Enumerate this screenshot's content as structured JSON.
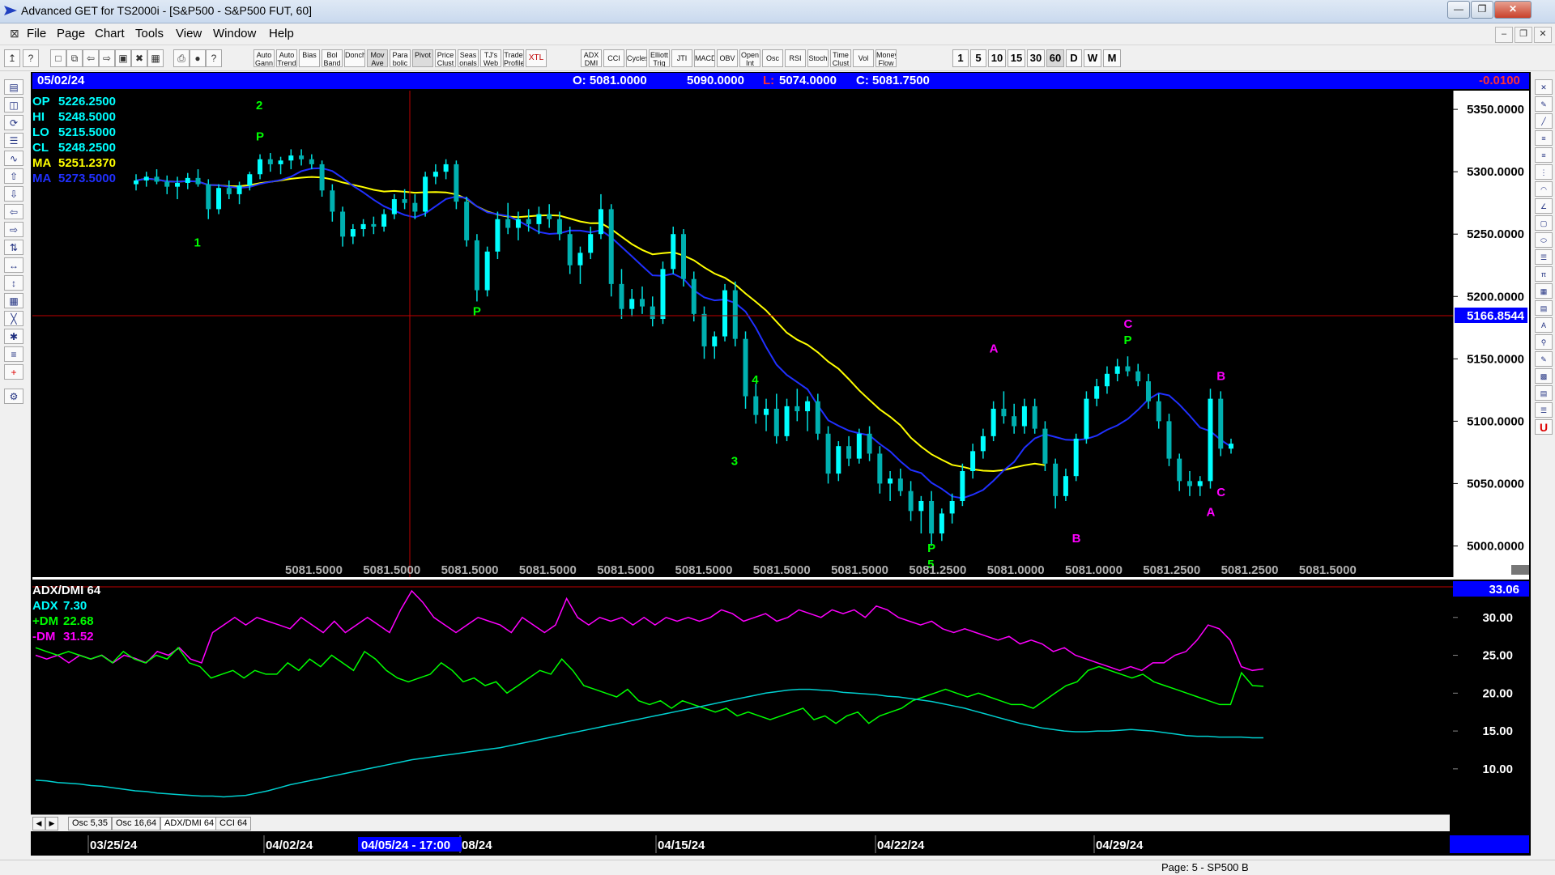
{
  "window": {
    "title": "Advanced GET for TS2000i - [S&P500 - S&P500 FUT, 60]"
  },
  "menu": [
    "File",
    "Page",
    "Chart",
    "Tools",
    "View",
    "Window",
    "Help"
  ],
  "toolbar": {
    "studies": [
      "Auto Gann",
      "Auto Trend",
      "Bias",
      "Bol Band",
      "Donch",
      "Mov Ave",
      "Para bolic",
      "Pivot",
      "Price Clust",
      "Seas onals",
      "TJ's Web",
      "Trade Profile",
      "XTL",
      "ADX DMI",
      "CCI",
      "Cycles",
      "Elliott Trig",
      "JTI",
      "MACD",
      "OBV",
      "Open Int",
      "Osc",
      "RSI",
      "Stoch",
      "Time Clust",
      "Vol",
      "Money Flow"
    ],
    "timeframes": [
      "1",
      "5",
      "10",
      "15",
      "30",
      "60",
      "D",
      "W",
      "M"
    ],
    "selected_timeframe": "60"
  },
  "infobar": {
    "date": "05/02/24",
    "open": "O: 5081.0000",
    "high": "5090.0000",
    "low_label": "L:",
    "low": "5074.0000",
    "close": "C: 5081.7500",
    "change": "-0.0100"
  },
  "price_panel": {
    "legend": [
      {
        "label": "OP",
        "value": "5226.2500",
        "color": "#00ffff"
      },
      {
        "label": "HI",
        "value": "5248.5000",
        "color": "#00ffff"
      },
      {
        "label": "LO",
        "value": "5215.5000",
        "color": "#00ffff"
      },
      {
        "label": "CL",
        "value": "5248.2500",
        "color": "#00ffff"
      },
      {
        "label": "MA",
        "value": "5251.2370",
        "color": "#ffff00"
      },
      {
        "label": "MA",
        "value": "5273.5000",
        "color": "#2030ff"
      }
    ],
    "axis_labels": [
      "5350.0000",
      "5300.0000",
      "5250.0000",
      "5200.0000",
      "5150.0000",
      "5100.0000",
      "5050.0000",
      "5000.0000"
    ],
    "crosshair_price": "5166.8544",
    "bottom_values": [
      "5081.5000",
      "5081.5000",
      "5081.5000",
      "5081.5000",
      "5081.5000",
      "5081.5000",
      "5081.5000",
      "5081.5000",
      "5081.2500",
      "5081.0000",
      "5081.0000",
      "5081.2500",
      "5081.2500",
      "5081.5000"
    ],
    "last_value": "5081.7500"
  },
  "indicator_panel": {
    "title": "ADX/DMI 64",
    "legend": [
      {
        "label": "ADX",
        "value": "7.30",
        "color": "#00ffff"
      },
      {
        "label": "+DM",
        "value": "22.68",
        "color": "#00ff00"
      },
      {
        "label": "-DM",
        "value": "31.52",
        "color": "#ff00ff"
      }
    ],
    "axis_labels": [
      "30.00",
      "25.00",
      "20.00",
      "15.00",
      "10.00"
    ],
    "crosshair_value": "33.06"
  },
  "tabs": [
    "Osc 5,35",
    "Osc 16,64",
    "ADX/DMI 64",
    "CCI 64"
  ],
  "active_tab": "ADX/DMI 64",
  "date_axis": {
    "labels": [
      "03/25/24",
      "04/02/24",
      "08/24",
      "04/15/24",
      "04/22/24",
      "04/29/24"
    ],
    "cursor_label": "04/05/24 - 17:00"
  },
  "status": "Page: 5 - SP500 B",
  "chart_data": {
    "type": "candlestick",
    "ylim": [
      4975,
      5365
    ],
    "labels": [
      {
        "text": "1",
        "color": "#00ff00",
        "price": 5240
      },
      {
        "text": "2",
        "color": "#00ff00",
        "price": 5350
      },
      {
        "text": "P",
        "color": "#00ff00",
        "price": 5325
      },
      {
        "text": "P",
        "color": "#00ff00",
        "price": 5185
      },
      {
        "text": "4",
        "color": "#00ff00",
        "price": 5130
      },
      {
        "text": "3",
        "color": "#00ff00",
        "price": 5065
      },
      {
        "text": "P",
        "color": "#00ff00",
        "price": 4995
      },
      {
        "text": "5",
        "color": "#00ff00",
        "price": 4982
      },
      {
        "text": "A",
        "color": "#ff00ff",
        "price": 5155
      },
      {
        "text": "B",
        "color": "#ff00ff",
        "price": 5003
      },
      {
        "text": "C",
        "color": "#ff00ff",
        "price": 5175
      },
      {
        "text": "P",
        "color": "#00ff00",
        "price": 5162
      },
      {
        "text": "B",
        "color": "#ff00ff",
        "price": 5133
      },
      {
        "text": "C",
        "color": "#ff00ff",
        "price": 5040
      },
      {
        "text": "A",
        "color": "#ff00ff",
        "price": 5024
      }
    ],
    "candles": [
      [
        5290,
        5298,
        5285,
        5293
      ],
      [
        5293,
        5300,
        5288,
        5296
      ],
      [
        5296,
        5302,
        5290,
        5292
      ],
      [
        5292,
        5297,
        5282,
        5288
      ],
      [
        5288,
        5296,
        5278,
        5291
      ],
      [
        5291,
        5299,
        5286,
        5295
      ],
      [
        5295,
        5302,
        5288,
        5290
      ],
      [
        5290,
        5294,
        5262,
        5270
      ],
      [
        5270,
        5290,
        5266,
        5287
      ],
      [
        5287,
        5293,
        5278,
        5282
      ],
      [
        5282,
        5292,
        5274,
        5289
      ],
      [
        5289,
        5300,
        5285,
        5298
      ],
      [
        5298,
        5314,
        5294,
        5310
      ],
      [
        5310,
        5315,
        5300,
        5306
      ],
      [
        5306,
        5312,
        5298,
        5309
      ],
      [
        5309,
        5318,
        5302,
        5313
      ],
      [
        5313,
        5318,
        5305,
        5310
      ],
      [
        5310,
        5314,
        5302,
        5306
      ],
      [
        5306,
        5309,
        5280,
        5285
      ],
      [
        5285,
        5290,
        5260,
        5268
      ],
      [
        5268,
        5272,
        5240,
        5248
      ],
      [
        5248,
        5258,
        5242,
        5254
      ],
      [
        5254,
        5262,
        5248,
        5258
      ],
      [
        5258,
        5264,
        5250,
        5256
      ],
      [
        5256,
        5270,
        5252,
        5266
      ],
      [
        5266,
        5282,
        5262,
        5278
      ],
      [
        5278,
        5286,
        5270,
        5275
      ],
      [
        5275,
        5282,
        5262,
        5268
      ],
      [
        5268,
        5300,
        5264,
        5296
      ],
      [
        5296,
        5306,
        5290,
        5300
      ],
      [
        5300,
        5310,
        5294,
        5306
      ],
      [
        5306,
        5309,
        5270,
        5276
      ],
      [
        5276,
        5280,
        5240,
        5245
      ],
      [
        5245,
        5250,
        5196,
        5205
      ],
      [
        5205,
        5240,
        5200,
        5236
      ],
      [
        5236,
        5268,
        5230,
        5262
      ],
      [
        5262,
        5275,
        5250,
        5255
      ],
      [
        5255,
        5268,
        5245,
        5262
      ],
      [
        5262,
        5270,
        5252,
        5258
      ],
      [
        5258,
        5272,
        5250,
        5266
      ],
      [
        5266,
        5274,
        5255,
        5262
      ],
      [
        5262,
        5268,
        5245,
        5250
      ],
      [
        5250,
        5256,
        5218,
        5225
      ],
      [
        5225,
        5240,
        5210,
        5235
      ],
      [
        5235,
        5256,
        5230,
        5250
      ],
      [
        5250,
        5282,
        5246,
        5270
      ],
      [
        5270,
        5274,
        5200,
        5210
      ],
      [
        5210,
        5222,
        5182,
        5190
      ],
      [
        5190,
        5206,
        5184,
        5198
      ],
      [
        5198,
        5208,
        5186,
        5192
      ],
      [
        5192,
        5200,
        5176,
        5182
      ],
      [
        5182,
        5228,
        5178,
        5222
      ],
      [
        5222,
        5256,
        5218,
        5250
      ],
      [
        5250,
        5254,
        5208,
        5214
      ],
      [
        5214,
        5220,
        5180,
        5186
      ],
      [
        5186,
        5192,
        5150,
        5160
      ],
      [
        5160,
        5172,
        5150,
        5168
      ],
      [
        5168,
        5210,
        5164,
        5205
      ],
      [
        5205,
        5212,
        5160,
        5166
      ],
      [
        5166,
        5172,
        5110,
        5120
      ],
      [
        5120,
        5130,
        5098,
        5105
      ],
      [
        5105,
        5118,
        5092,
        5110
      ],
      [
        5110,
        5122,
        5082,
        5088
      ],
      [
        5088,
        5118,
        5084,
        5112
      ],
      [
        5112,
        5126,
        5100,
        5108
      ],
      [
        5108,
        5120,
        5092,
        5116
      ],
      [
        5116,
        5122,
        5085,
        5090
      ],
      [
        5090,
        5096,
        5050,
        5058
      ],
      [
        5058,
        5084,
        5052,
        5080
      ],
      [
        5080,
        5088,
        5064,
        5070
      ],
      [
        5070,
        5094,
        5066,
        5090
      ],
      [
        5090,
        5096,
        5068,
        5074
      ],
      [
        5074,
        5080,
        5042,
        5050
      ],
      [
        5050,
        5060,
        5036,
        5054
      ],
      [
        5054,
        5062,
        5040,
        5044
      ],
      [
        5044,
        5052,
        5020,
        5028
      ],
      [
        5028,
        5040,
        5010,
        5036
      ],
      [
        5036,
        5044,
        5000,
        5010
      ],
      [
        5010,
        5030,
        5004,
        5026
      ],
      [
        5026,
        5042,
        5018,
        5036
      ],
      [
        5036,
        5066,
        5032,
        5060
      ],
      [
        5060,
        5082,
        5054,
        5076
      ],
      [
        5076,
        5094,
        5070,
        5088
      ],
      [
        5088,
        5116,
        5084,
        5110
      ],
      [
        5110,
        5124,
        5098,
        5104
      ],
      [
        5104,
        5114,
        5090,
        5096
      ],
      [
        5096,
        5118,
        5090,
        5112
      ],
      [
        5112,
        5118,
        5090,
        5094
      ],
      [
        5094,
        5100,
        5060,
        5066
      ],
      [
        5066,
        5070,
        5030,
        5040
      ],
      [
        5040,
        5062,
        5036,
        5056
      ],
      [
        5056,
        5090,
        5052,
        5086
      ],
      [
        5086,
        5124,
        5082,
        5118
      ],
      [
        5118,
        5134,
        5112,
        5128
      ],
      [
        5128,
        5144,
        5122,
        5138
      ],
      [
        5138,
        5150,
        5132,
        5144
      ],
      [
        5144,
        5152,
        5136,
        5140
      ],
      [
        5140,
        5146,
        5128,
        5132
      ],
      [
        5132,
        5138,
        5110,
        5116
      ],
      [
        5116,
        5122,
        5094,
        5100
      ],
      [
        5100,
        5106,
        5064,
        5070
      ],
      [
        5070,
        5074,
        5044,
        5052
      ],
      [
        5052,
        5060,
        5040,
        5048
      ],
      [
        5048,
        5056,
        5040,
        5052
      ],
      [
        5052,
        5126,
        5046,
        5118
      ],
      [
        5118,
        5124,
        5072,
        5078
      ],
      [
        5078,
        5086,
        5074,
        5082
      ]
    ]
  }
}
